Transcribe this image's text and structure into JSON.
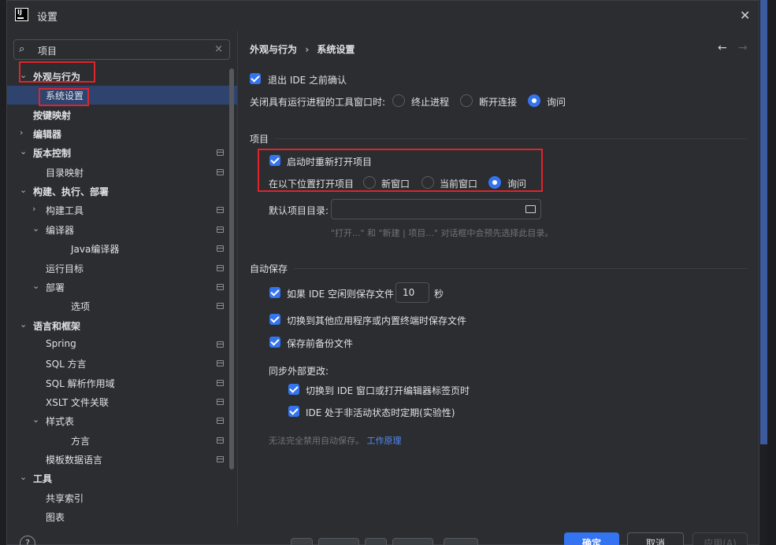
{
  "window": {
    "title": "设置",
    "close_glyph": "✕"
  },
  "search": {
    "value": "项目",
    "icon": "search-icon",
    "clear_glyph": "×"
  },
  "tree": [
    {
      "label": "外观与行为",
      "chev": "⌄",
      "bold": true
    },
    {
      "label": "系统设置",
      "chev": "",
      "bold": false,
      "selected": true
    },
    {
      "label": "按键映射",
      "chev": "",
      "bold": true
    },
    {
      "label": "编辑器",
      "chev": "›",
      "bold": true
    },
    {
      "label": "版本控制",
      "chev": "⌄",
      "bold": true,
      "pin": true
    },
    {
      "label": "目录映射",
      "chev": "",
      "bold": false,
      "pin": true
    },
    {
      "label": "构建、执行、部署",
      "chev": "⌄",
      "bold": true
    },
    {
      "label": "构建工具",
      "chev": "›",
      "bold": false,
      "pin": true
    },
    {
      "label": "编译器",
      "chev": "⌄",
      "bold": false,
      "pin": true
    },
    {
      "label": "Java编译器",
      "chev": "",
      "bold": false,
      "pin": true
    },
    {
      "label": "运行目标",
      "chev": "",
      "bold": false,
      "pin": true
    },
    {
      "label": "部署",
      "chev": "⌄",
      "bold": false,
      "pin": true
    },
    {
      "label": "选项",
      "chev": "",
      "bold": false,
      "pin": true
    },
    {
      "label": "语言和框架",
      "chev": "⌄",
      "bold": true
    },
    {
      "label": "Spring",
      "chev": "",
      "bold": false,
      "pin": true
    },
    {
      "label": "SQL 方言",
      "chev": "",
      "bold": false,
      "pin": true
    },
    {
      "label": "SQL 解析作用域",
      "chev": "",
      "bold": false,
      "pin": true
    },
    {
      "label": "XSLT 文件关联",
      "chev": "",
      "bold": false,
      "pin": true
    },
    {
      "label": "样式表",
      "chev": "⌄",
      "bold": false,
      "pin": true
    },
    {
      "label": "方言",
      "chev": "",
      "bold": false,
      "pin": true
    },
    {
      "label": "模板数据语言",
      "chev": "",
      "bold": false,
      "pin": true
    },
    {
      "label": "工具",
      "chev": "⌄",
      "bold": true
    },
    {
      "label": "共享索引",
      "chev": "",
      "bold": false
    },
    {
      "label": "图表",
      "chev": "",
      "bold": false
    }
  ],
  "breadcrumb": {
    "parent": "外观与行为",
    "separator": "›",
    "current": "系统设置"
  },
  "nav": {
    "back": "←",
    "forward": "→"
  },
  "general": {
    "confirm_exit": "退出 IDE 之前确认",
    "close_tool_label": "关闭具有运行进程的工具窗口时:",
    "close_tool_options": [
      "终止进程",
      "断开连接",
      "询问"
    ],
    "close_tool_selected": "询问"
  },
  "project": {
    "section": "项目",
    "reopen": "启动时重新打开项目",
    "open_in_label": "在以下位置打开项目",
    "open_in_options": [
      "新窗口",
      "当前窗口",
      "询问"
    ],
    "open_in_selected": "询问",
    "default_dir_label": "默认项目目录:",
    "default_dir_value": "",
    "default_dir_hint": "\"打开...\" 和 \"新建 | 项目...\" 对话框中会预先选择此目录。"
  },
  "autosave": {
    "section": "自动保存",
    "idle_prefix": "如果 IDE 空闲则保存文件",
    "idle_value": "10",
    "idle_unit": "秒",
    "switch_save": "切换到其他应用程序或内置终端时保存文件",
    "backup": "保存前备份文件",
    "sync_label": "同步外部更改:",
    "sync_switch": "切换到 IDE 窗口或打开编辑器标签页时",
    "sync_inactive": "IDE 处于非活动状态时定期(实验性)",
    "note_text": "无法完全禁用自动保存。",
    "note_link": "工作原理"
  },
  "buttons": {
    "help": "?",
    "ok": "确定",
    "cancel": "取消",
    "apply": "应用(A)"
  },
  "colors": {
    "accent": "#3574f0",
    "annotation": "#e0242c",
    "selection": "#2e436e"
  }
}
